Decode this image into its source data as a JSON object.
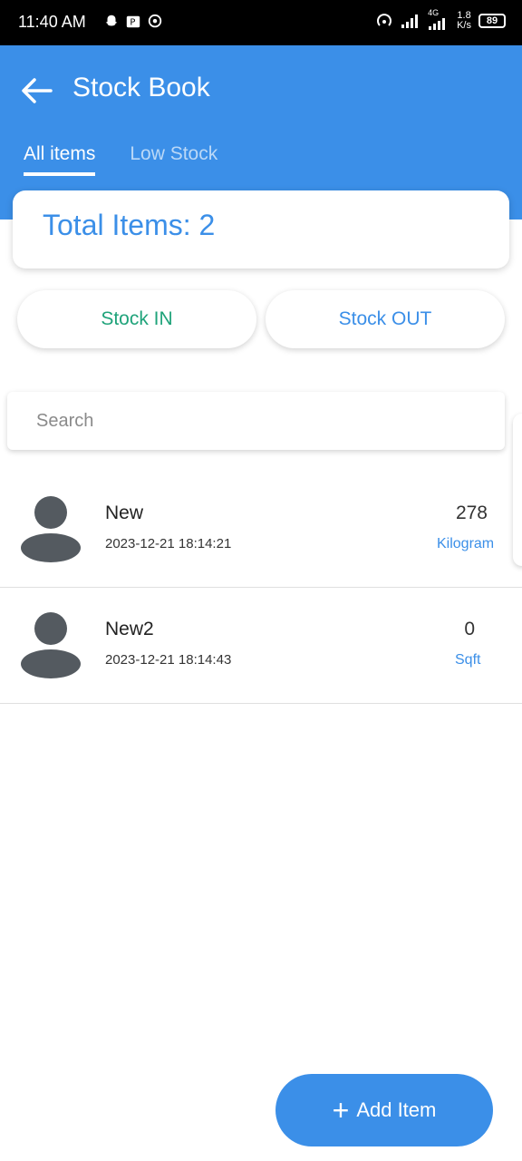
{
  "status_bar": {
    "time": "11:40 AM",
    "network_type": "4G",
    "net_speed_value": "1.8",
    "net_speed_unit": "K/s",
    "battery": "89",
    "left_icons": [
      "snapchat-icon",
      "parking-icon",
      "location-icon"
    ],
    "right_icons": [
      "hotspot-icon",
      "signal-icon",
      "signal-4g-icon"
    ]
  },
  "header": {
    "title": "Stock Book",
    "back_icon": "arrow-left-icon",
    "tabs": [
      {
        "label": "All items",
        "active": true
      },
      {
        "label": "Low Stock",
        "active": false
      }
    ]
  },
  "summary": {
    "total_items_text": "Total Items: 2"
  },
  "actions": {
    "stock_in_label": "Stock IN",
    "stock_out_label": "Stock OUT"
  },
  "search": {
    "placeholder": "Search",
    "value": ""
  },
  "items": [
    {
      "name": "New",
      "timestamp": "2023-12-21 18:14:21",
      "quantity": "278",
      "unit": "Kilogram",
      "avatar_icon": "person-avatar-icon"
    },
    {
      "name": "New2",
      "timestamp": "2023-12-21 18:14:43",
      "quantity": "0",
      "unit": "Sqft",
      "avatar_icon": "person-avatar-icon"
    }
  ],
  "fab": {
    "label": "Add Item",
    "icon": "plus-icon"
  },
  "colors": {
    "primary": "#3b8fe8",
    "stock_in_text": "#1fa37a",
    "status_bar_bg": "#000000",
    "avatar_fill": "#545a60"
  }
}
